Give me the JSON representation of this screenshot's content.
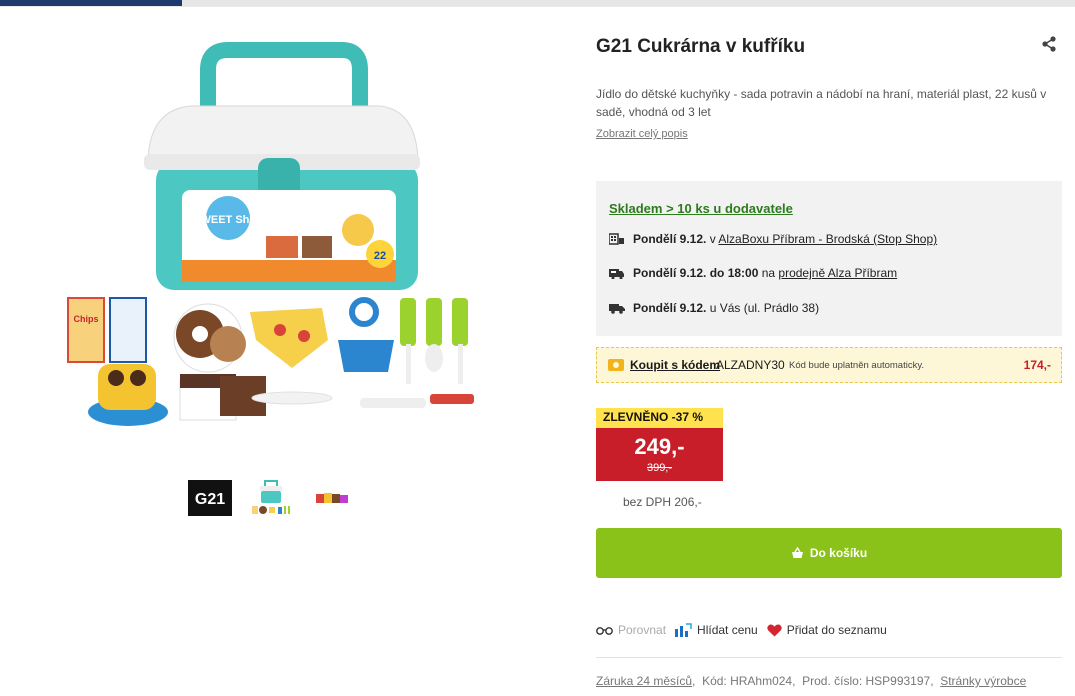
{
  "product": {
    "title": "G21 Cukrárna v kufříku",
    "description": "Jídlo do dětské kuchyňky - sada potravin a nádobí na hraní, materiál plast, 22 kusů v sadě, vhodná od 3 let",
    "more_link": "Zobrazit celý popis",
    "image_box_text": "SWEET Shop",
    "image_box_count": "22",
    "image_chips_label": "Chips",
    "thumb_logo_text": "G21"
  },
  "availability": {
    "headline": "Skladem > 10 ks u dodavatele",
    "rows": [
      {
        "icon": "alzabox-icon",
        "date": "Pondělí 9.12.",
        "prefix": " v ",
        "link": "AlzaBoxu Příbram - Brodská (Stop Shop)",
        "suffix": ""
      },
      {
        "icon": "store-icon",
        "date": "Pondělí 9.12. do 18:00",
        "prefix": " na ",
        "link": "prodejně Alza Příbram",
        "suffix": ""
      },
      {
        "icon": "truck-icon",
        "date": "Pondělí 9.12.",
        "prefix": " u Vás (ul. Prádlo 38)",
        "link": "",
        "suffix": ""
      }
    ]
  },
  "coupon": {
    "link": "Koupit s kódem",
    "code": "ALZADNY30",
    "note": "Kód bude uplatněn automaticky.",
    "amount": "174,-"
  },
  "pricing": {
    "discount": "ZLEVNĚNO -37 %",
    "price": "249,-",
    "old_price": "399,-",
    "no_vat": "bez DPH 206,-"
  },
  "cart": {
    "label": "Do košíku"
  },
  "actions": {
    "compare": "Porovnat",
    "watch": "Hlídat cenu",
    "wishlist": "Přidat do seznamu"
  },
  "footer": {
    "warranty": "Záruka 24 měsíců",
    "code_label": "Kód: HRAhm024",
    "prod_label": "Prod. číslo: HSP993197",
    "maker": "Stránky výrobce"
  },
  "colors": {
    "price_red": "#c81e2a",
    "discount_yellow": "#ffe24d",
    "cart_green": "#8bc21a",
    "stock_green": "#2c7b1d",
    "brand_blue": "#1d3a6e"
  }
}
